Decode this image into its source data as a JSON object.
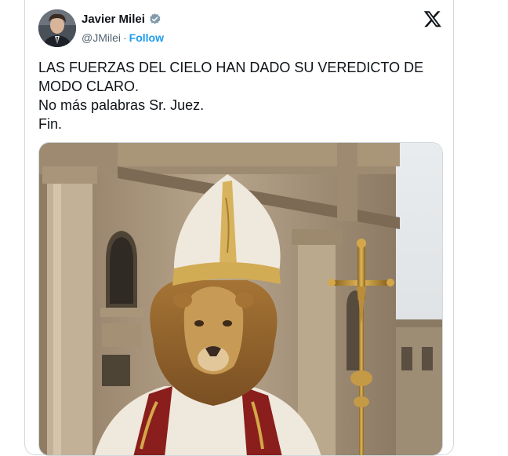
{
  "tweet": {
    "author": {
      "name": "Javier Milei",
      "handle": "@JMilei",
      "separator": "·",
      "follow_label": "Follow"
    },
    "lines": [
      "LAS FUERZAS DEL CIELO HAN DADO SU VEREDICTO DE",
      "MODO CLARO.",
      "No más palabras Sr. Juez.",
      "Fin."
    ],
    "media": {
      "subject": "lion wearing papal mitre and vestments holding a golden cross staff in front of a classical building"
    },
    "icons": {
      "verified": "verified-badge-icon",
      "platform": "x-logo-icon"
    }
  },
  "colors": {
    "link": "#1d9bf0",
    "text": "#0f1419",
    "muted": "#536471",
    "border": "#cfd9de"
  }
}
